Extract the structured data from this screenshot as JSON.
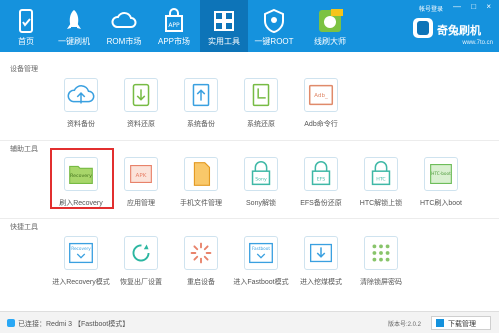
{
  "colors": {
    "accent": "#1592dd",
    "accent_dark": "#0d74b8",
    "highlight": "#e22f2f"
  },
  "nav": [
    {
      "label": "首页",
      "icon": "phone-icon"
    },
    {
      "label": "一键刷机",
      "icon": "rocket-icon"
    },
    {
      "label": "ROM市场",
      "icon": "cloud-icon"
    },
    {
      "label": "APP市场",
      "icon": "app-bag-icon"
    },
    {
      "label": "实用工具",
      "icon": "grid-tools-icon",
      "active": true
    },
    {
      "label": "一键ROOT",
      "icon": "shield-root-icon"
    },
    {
      "label": "线刷大师",
      "icon": "master-icon"
    }
  ],
  "header": {
    "login": "帐号登录",
    "window_buttons": "— □ ×",
    "brand": "奇兔刷机",
    "url": "www.7to.cn"
  },
  "sections": [
    {
      "title": "设备管理",
      "tools": [
        {
          "label": "资料备份",
          "icon": "cloud-upload-icon"
        },
        {
          "label": "资料还原",
          "icon": "tablet-restore-icon"
        },
        {
          "label": "系统备份",
          "icon": "system-backup-icon"
        },
        {
          "label": "系统还原",
          "icon": "system-restore-icon"
        },
        {
          "label": "Adb命令行",
          "icon": "terminal-icon",
          "badge": "Adb_"
        }
      ]
    },
    {
      "title": "辅助工具",
      "tools": [
        {
          "label": "刷入Recovery",
          "icon": "recovery-folder-icon",
          "badge": "Recovery",
          "highlighted": true
        },
        {
          "label": "应用管理",
          "icon": "apk-icon",
          "badge": "APK"
        },
        {
          "label": "手机文件管理",
          "icon": "file-manager-icon"
        },
        {
          "label": "Sony解锁",
          "icon": "sony-lock-icon",
          "badge": "Sony"
        },
        {
          "label": "EFS备份还原",
          "icon": "efs-lock-icon",
          "badge": "EFS"
        },
        {
          "label": "HTC解锁上锁",
          "icon": "htc-lock-icon",
          "badge": "HTC"
        },
        {
          "label": "HTC刷入boot",
          "icon": "htc-boot-icon",
          "badge": "HTC-boot"
        }
      ]
    },
    {
      "title": "快捷工具",
      "tools": [
        {
          "label": "进入Recovery模式",
          "icon": "recovery-mode-icon",
          "badge": "Recovery"
        },
        {
          "label": "恢复出厂设置",
          "icon": "factory-reset-icon"
        },
        {
          "label": "重启设备",
          "icon": "reboot-icon"
        },
        {
          "label": "进入Fastboot模式",
          "icon": "fastboot-icon",
          "badge": "Fastboot"
        },
        {
          "label": "进入挖煤模式",
          "icon": "download-mode-icon"
        },
        {
          "label": "清除锁屏密码",
          "icon": "pattern-lock-icon"
        }
      ]
    }
  ],
  "status": {
    "device": "已连接：Redmi 3 【Fastboot模式】",
    "version": "版本号:2.0.2",
    "download": "下载管理"
  }
}
